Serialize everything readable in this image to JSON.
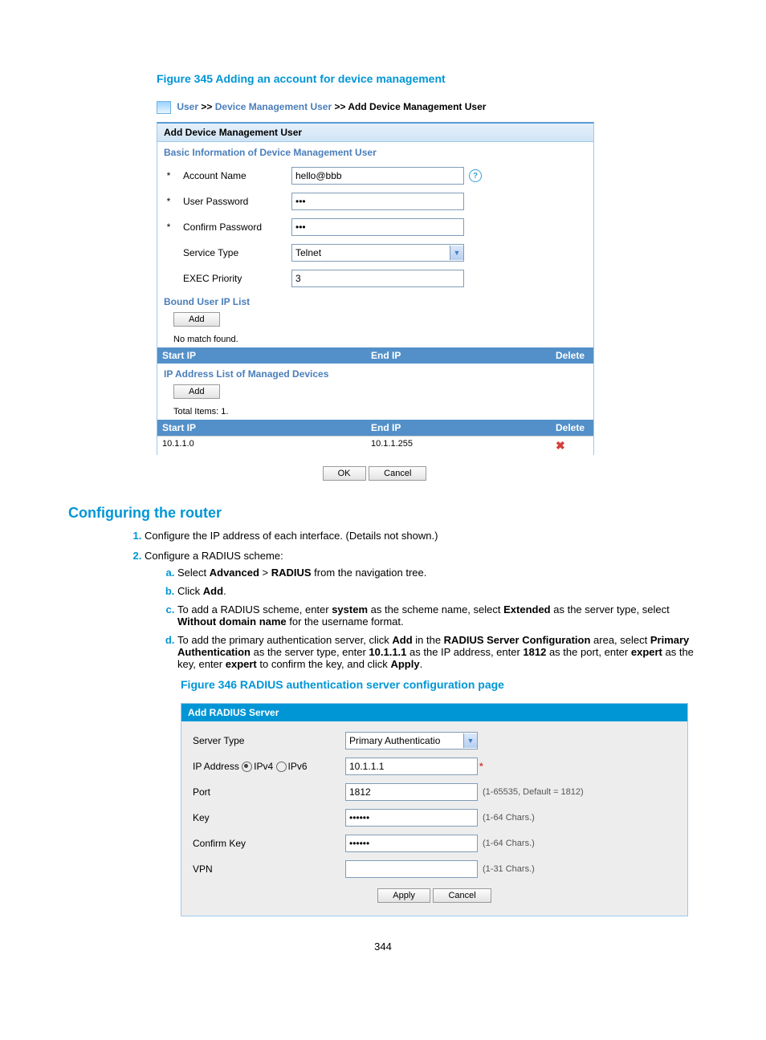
{
  "figure345": {
    "title": "Figure 345 Adding an account for device management",
    "breadcrumb": {
      "l1": "User",
      "sep": ">>",
      "l2": "Device Management User",
      "l3": "Add Device Management User"
    },
    "panel_title": "Add Device Management User",
    "section_basic": "Basic Information of Device Management User",
    "fields": {
      "account_name": {
        "label": "Account Name",
        "value": "hello@bbb",
        "required": "*"
      },
      "user_password": {
        "label": "User Password",
        "value": "•••",
        "required": "*"
      },
      "confirm_password": {
        "label": "Confirm Password",
        "value": "•••",
        "required": "*"
      },
      "service_type": {
        "label": "Service Type",
        "value": "Telnet"
      },
      "exec_priority": {
        "label": "EXEC Priority",
        "value": "3"
      }
    },
    "section_bound": "Bound User IP List",
    "add_btn": "Add",
    "no_match": "No match found.",
    "cols": {
      "start": "Start IP",
      "end": "End IP",
      "delete": "Delete"
    },
    "section_managed": "IP Address List of Managed Devices",
    "total_items": "Total Items: 1.",
    "row": {
      "start": "10.1.1.0",
      "end": "10.1.1.255"
    },
    "ok": "OK",
    "cancel": "Cancel"
  },
  "router_section": {
    "heading": "Configuring the router",
    "step1": "Configure the IP address of each interface. (Details not shown.)",
    "step2": "Configure a RADIUS scheme:",
    "sub": {
      "a_pre": "Select ",
      "a_b1": "Advanced",
      "a_mid": " > ",
      "a_b2": "RADIUS",
      "a_post": " from the navigation tree.",
      "b_pre": "Click ",
      "b_b": "Add",
      "b_post": ".",
      "c_1": "To add a RADIUS scheme, enter ",
      "c_b1": "system",
      "c_2": " as the scheme name, select ",
      "c_b2": "Extended",
      "c_3": " as the server type, select ",
      "c_b3": "Without domain name",
      "c_4": " for the username format.",
      "d_1": "To add the primary authentication server, click ",
      "d_b1": "Add",
      "d_2": " in the ",
      "d_b2": "RADIUS Server Configuration",
      "d_3": " area, select ",
      "d_b3": "Primary Authentication",
      "d_4": " as the server type, enter ",
      "d_b4": "10.1.1.1",
      "d_5": " as the IP address, enter ",
      "d_b5": "1812",
      "d_6": " as the port, enter ",
      "d_b6": "expert",
      "d_7": " as the key, enter ",
      "d_b7": "expert",
      "d_8": " to confirm the key, and click ",
      "d_b8": "Apply",
      "d_9": "."
    }
  },
  "figure346": {
    "title": "Figure 346 RADIUS authentication server configuration page",
    "panel_title": "Add RADIUS Server",
    "fields": {
      "server_type": {
        "label": "Server Type",
        "value": "Primary Authenticatio"
      },
      "ip_label": "IP Address",
      "ipv4": "IPv4",
      "ipv6": "IPv6",
      "ip_value": "10.1.1.1",
      "port": {
        "label": "Port",
        "value": "1812",
        "hint": "(1-65535, Default = 1812)"
      },
      "key": {
        "label": "Key",
        "value": "••••••",
        "hint": "(1-64 Chars.)"
      },
      "confirm_key": {
        "label": "Confirm Key",
        "value": "••••••",
        "hint": "(1-64 Chars.)"
      },
      "vpn": {
        "label": "VPN",
        "value": "",
        "hint": "(1-31 Chars.)"
      }
    },
    "apply": "Apply",
    "cancel": "Cancel"
  },
  "page_number": "344"
}
